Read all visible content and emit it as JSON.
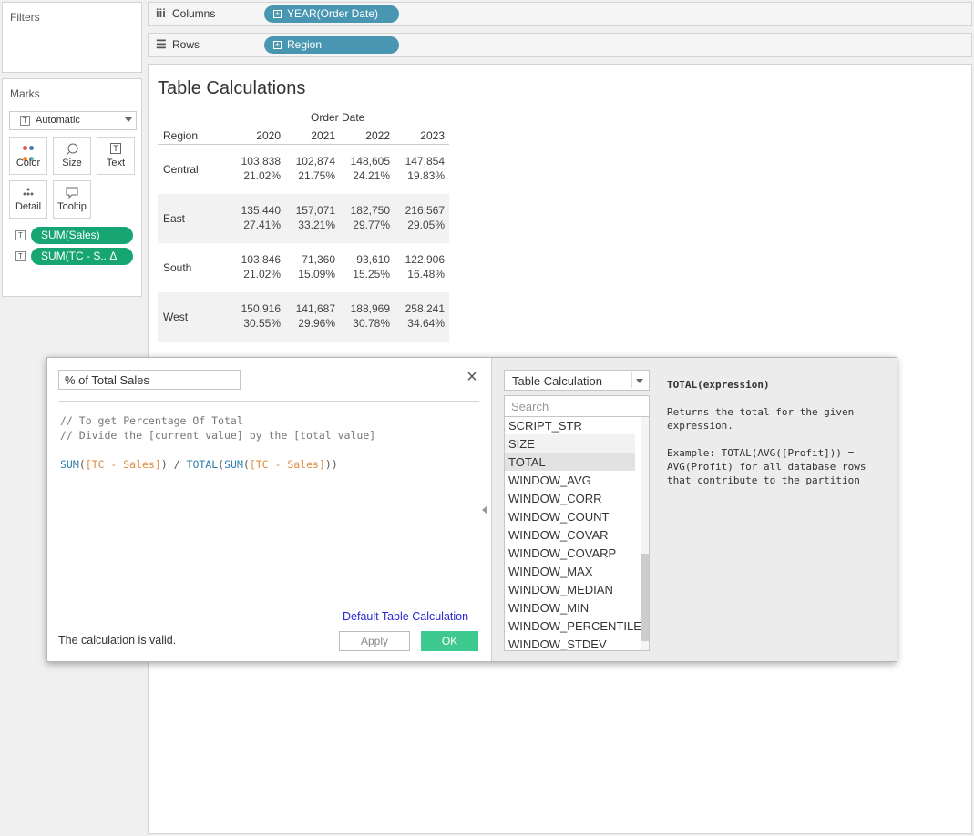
{
  "filters": {
    "title": "Filters"
  },
  "shelves": {
    "columns": {
      "label": "Columns",
      "pill": "YEAR(Order Date)"
    },
    "rows": {
      "label": "Rows",
      "pill": "Region"
    }
  },
  "marks": {
    "title": "Marks",
    "mark_type": "Automatic",
    "buttons": {
      "color": "Color",
      "size": "Size",
      "text": "Text",
      "detail": "Detail",
      "tooltip": "Tooltip"
    },
    "pills": [
      "SUM(Sales)",
      "SUM(TC - S.. Δ"
    ]
  },
  "viz": {
    "title": "Table Calculations",
    "column_header": "Order Date",
    "row_header": "Region",
    "years": [
      "2020",
      "2021",
      "2022",
      "2023"
    ],
    "rows": [
      {
        "region": "Central",
        "sales": [
          "103,838",
          "102,874",
          "148,605",
          "147,854"
        ],
        "pct": [
          "21.02%",
          "21.75%",
          "24.21%",
          "19.83%"
        ]
      },
      {
        "region": "East",
        "sales": [
          "135,440",
          "157,071",
          "182,750",
          "216,567"
        ],
        "pct": [
          "27.41%",
          "33.21%",
          "29.77%",
          "29.05%"
        ]
      },
      {
        "region": "South",
        "sales": [
          "103,846",
          "71,360",
          "93,610",
          "122,906"
        ],
        "pct": [
          "21.02%",
          "15.09%",
          "15.25%",
          "16.48%"
        ]
      },
      {
        "region": "West",
        "sales": [
          "150,916",
          "141,687",
          "188,969",
          "258,241"
        ],
        "pct": [
          "30.55%",
          "29.96%",
          "30.78%",
          "34.64%"
        ]
      }
    ]
  },
  "dialog": {
    "calc_name": "% of Total Sales",
    "code": {
      "comment1": "// To get Percentage Of Total",
      "comment2": "// Divide the [current value] by the [total value]",
      "fn_sum": "SUM",
      "field": "[TC - Sales]",
      "slash": " / ",
      "fn_total": "TOTAL"
    },
    "default_link": "Default Table Calculation",
    "status": "The calculation is valid.",
    "apply_label": "Apply",
    "ok_label": "OK",
    "function_category": "Table Calculation",
    "search_placeholder": "Search",
    "functions": [
      "SCRIPT_STR",
      "SIZE",
      "TOTAL",
      "WINDOW_AVG",
      "WINDOW_CORR",
      "WINDOW_COUNT",
      "WINDOW_COVAR",
      "WINDOW_COVARP",
      "WINDOW_MAX",
      "WINDOW_MEDIAN",
      "WINDOW_MIN",
      "WINDOW_PERCENTILE",
      "WINDOW_STDEV"
    ],
    "selected_function": "TOTAL",
    "help": {
      "signature": "TOTAL(expression)",
      "description": "Returns the total for the given expression.",
      "example": "Example: TOTAL(AVG([Profit])) = AVG(Profit) for all database rows that contribute to the partition"
    }
  },
  "colors": {
    "blue_pill": "#4996b2",
    "green_pill": "#17a673",
    "ok_button": "#3ec98e",
    "link": "#2929d6"
  }
}
